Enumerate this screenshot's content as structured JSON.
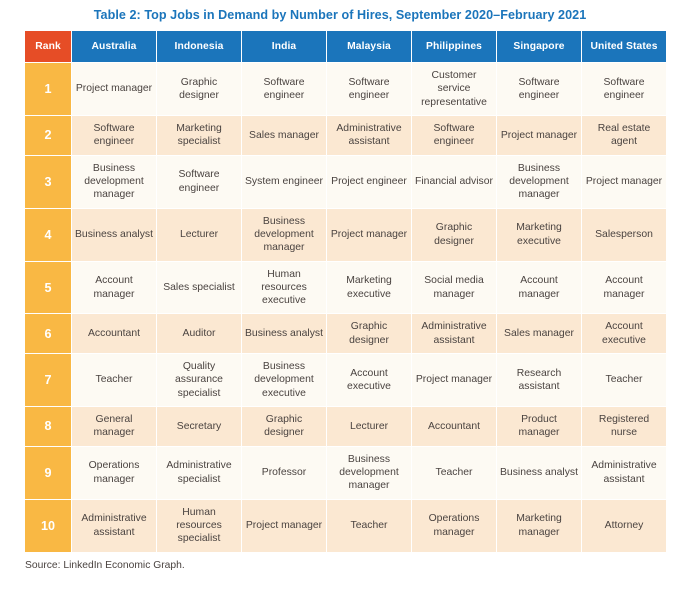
{
  "title": "Table 2: Top Jobs in Demand by Number of Hires, September 2020–February 2021",
  "source": "Source: LinkedIn Economic Graph.",
  "colors": {
    "title": "#1b75bb",
    "header_blue": "#1b75bb",
    "header_rank_orange": "#e64d26",
    "rank_cell_amber": "#f9b844",
    "row_odd": "#fdfaf3",
    "row_even": "#fbe8d2",
    "text": "#4a4340"
  },
  "table": {
    "columns": [
      "Rank",
      "Australia",
      "Indonesia",
      "India",
      "Malaysia",
      "Philippines",
      "Singapore",
      "United States"
    ],
    "rows": [
      {
        "rank": "1",
        "cells": [
          "Project manager",
          "Graphic designer",
          "Software engineer",
          "Software engineer",
          "Customer service representative",
          "Software engineer",
          "Software engineer"
        ]
      },
      {
        "rank": "2",
        "cells": [
          "Software engineer",
          "Marketing specialist",
          "Sales manager",
          "Administrative assistant",
          "Software engineer",
          "Project manager",
          "Real estate agent"
        ]
      },
      {
        "rank": "3",
        "cells": [
          "Business development manager",
          "Software engineer",
          "System engineer",
          "Project engineer",
          "Financial advisor",
          "Business development manager",
          "Project manager"
        ]
      },
      {
        "rank": "4",
        "cells": [
          "Business analyst",
          "Lecturer",
          "Business development manager",
          "Project manager",
          "Graphic designer",
          "Marketing executive",
          "Salesperson"
        ]
      },
      {
        "rank": "5",
        "cells": [
          "Account manager",
          "Sales specialist",
          "Human resources executive",
          "Marketing executive",
          "Social media manager",
          "Account manager",
          "Account manager"
        ]
      },
      {
        "rank": "6",
        "cells": [
          "Accountant",
          "Auditor",
          "Business analyst",
          "Graphic designer",
          "Administrative assistant",
          "Sales manager",
          "Account executive"
        ]
      },
      {
        "rank": "7",
        "cells": [
          "Teacher",
          "Quality assurance specialist",
          "Business development executive",
          "Account executive",
          "Project manager",
          "Research assistant",
          "Teacher"
        ]
      },
      {
        "rank": "8",
        "cells": [
          "General manager",
          "Secretary",
          "Graphic designer",
          "Lecturer",
          "Accountant",
          "Product manager",
          "Registered nurse"
        ]
      },
      {
        "rank": "9",
        "cells": [
          "Operations manager",
          "Administrative specialist",
          "Professor",
          "Business development manager",
          "Teacher",
          "Business analyst",
          "Administrative assistant"
        ]
      },
      {
        "rank": "10",
        "cells": [
          "Administrative assistant",
          "Human resources specialist",
          "Project manager",
          "Teacher",
          "Operations manager",
          "Marketing manager",
          "Attorney"
        ]
      }
    ]
  }
}
